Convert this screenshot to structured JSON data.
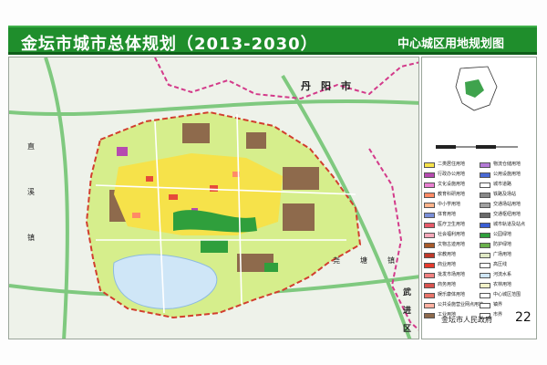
{
  "header": {
    "title": "金坛市城市总体规划（2013-2030）",
    "subtitle": "中心城区用地规划图",
    "bar_color": "#1f8e2c"
  },
  "map": {
    "labels": {
      "danyang": "丹　阳　市",
      "zhi_w1": "直",
      "zhi_w2": "溪",
      "zhi_w3": "镇",
      "zhen_e1": "尧",
      "zhen_e2": "塘",
      "zhen_e3": "镇",
      "wu": "武",
      "jin": "进",
      "qu": "区"
    },
    "land_use_colors": {
      "urban_area": "#d6ee8c",
      "residential": "#f6e24a",
      "industrial": "#8e6a4c",
      "green": "#2f9f3c",
      "water": "#cfe6f7",
      "public": "#e64a3a",
      "commercial": "#b64ab0",
      "education": "#ff8a65",
      "boundary": "#d33a8a",
      "planning_boundary": "#d23e2e"
    }
  },
  "legend": {
    "items": [
      {
        "label": "二类居住用地",
        "color": "#f6e24a"
      },
      {
        "label": "行政办公用地",
        "color": "#b64ab0"
      },
      {
        "label": "文化设施用地",
        "color": "#e87fd1"
      },
      {
        "label": "教育科研用地",
        "color": "#ff8a65"
      },
      {
        "label": "中小学用地",
        "color": "#ffb38a"
      },
      {
        "label": "体育用地",
        "color": "#7a8fd8"
      },
      {
        "label": "医疗卫生用地",
        "color": "#e65a6a"
      },
      {
        "label": "社会福利用地",
        "color": "#f4a7b9"
      },
      {
        "label": "文物古迹用地",
        "color": "#a85a2a"
      },
      {
        "label": "宗教用地",
        "color": "#c0392b"
      },
      {
        "label": "商业用地",
        "color": "#e63b2e"
      },
      {
        "label": "批发市场用地",
        "color": "#f08080"
      },
      {
        "label": "商务用地",
        "color": "#d9534f"
      },
      {
        "label": "娱乐康体用地",
        "color": "#e8746a"
      },
      {
        "label": "公共设施营业网点用地",
        "color": "#ffb0a0"
      },
      {
        "label": "工业用地",
        "color": "#8e6a4c"
      },
      {
        "label": "物流仓储用地",
        "color": "#b47ad6"
      },
      {
        "label": "公用设施用地",
        "color": "#4a69d4"
      },
      {
        "label": "城市道路",
        "color": "#ffffff"
      },
      {
        "label": "铁路及场站",
        "color": "#888888"
      },
      {
        "label": "交通场站用地",
        "color": "#a0a0a0"
      },
      {
        "label": "交通枢纽用地",
        "color": "#6a6a6a"
      },
      {
        "label": "城市轨道及站点",
        "color": "#3a5ed4"
      },
      {
        "label": "公园绿地",
        "color": "#2f9f3c"
      },
      {
        "label": "防护绿地",
        "color": "#6ab04c"
      },
      {
        "label": "广场用地",
        "color": "#dfe8c4"
      },
      {
        "label": "高压线",
        "color": "#ffffff"
      },
      {
        "label": "河流水系",
        "color": "#cfe6f7"
      },
      {
        "label": "农林用地",
        "color": "#f2f2c8"
      },
      {
        "label": "中心城区范围",
        "color": "#ffffff"
      },
      {
        "label": "镇界",
        "color": "#ffffff"
      },
      {
        "label": "市界",
        "color": "#ffffff"
      }
    ]
  },
  "footer": {
    "government": "金坛市人民政府",
    "page_number": "22"
  }
}
